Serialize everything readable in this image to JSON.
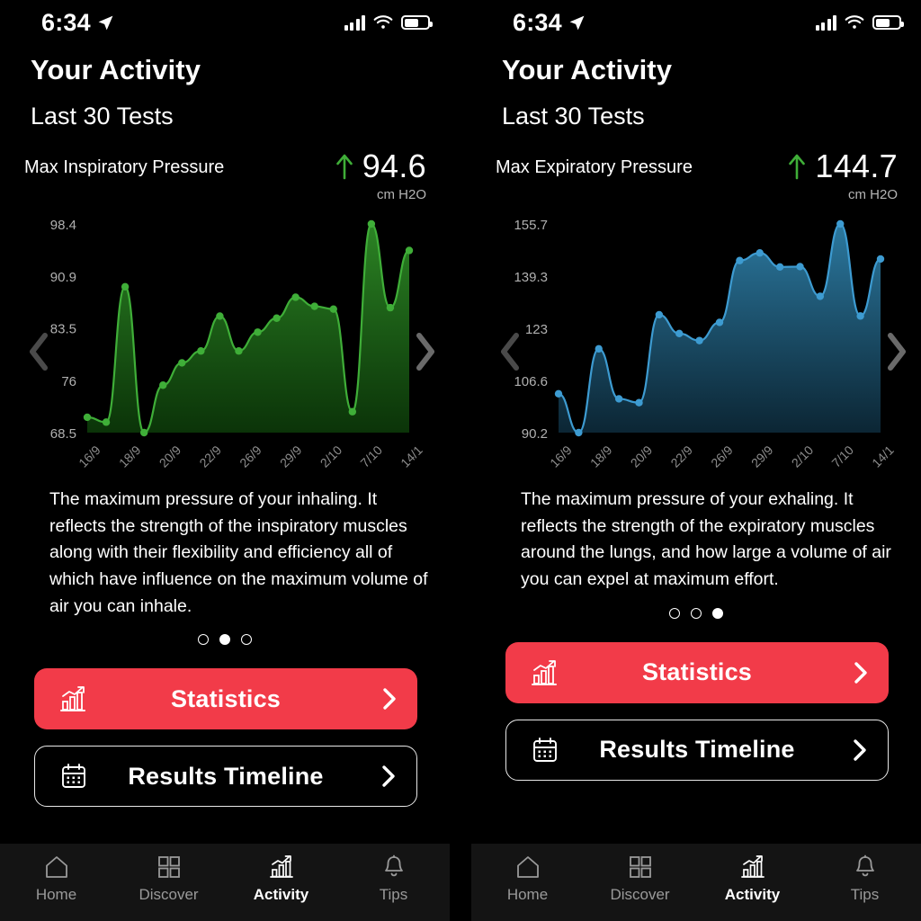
{
  "status_bar": {
    "time": "6:34",
    "icons": [
      "location-arrow-icon",
      "cellular-bars-icon",
      "wifi-icon",
      "battery-icon"
    ],
    "battery_level_pct": 62
  },
  "nav_tabs": [
    {
      "label": "Home",
      "icon": "home-icon",
      "active": false
    },
    {
      "label": "Discover",
      "icon": "grid-icon",
      "active": false
    },
    {
      "label": "Activity",
      "icon": "chart-up-icon",
      "active": true
    },
    {
      "label": "Tips",
      "icon": "bell-icon",
      "active": false
    }
  ],
  "colors": {
    "accent_red": "#f23b49",
    "green_line": "#3fae38",
    "blue_line": "#3d9bd1",
    "background": "#000000",
    "tabbar_bg": "#141414",
    "axis_text": "#b0b0b0"
  },
  "panels": [
    {
      "title": "Your Activity",
      "subtitle": "Last 30 Tests",
      "metric_name": "Max Inspiratory Pressure",
      "metric_value": "94.6",
      "metric_unit": "cm H2O",
      "trend": "up",
      "description": "The maximum pressure of your inhaling.  It reflects the strength of the inspiratory muscles along with their flexibility and efficiency all of which have influence on the maximum volume of air you can inhale.",
      "pager": {
        "count": 3,
        "active_index": 1
      },
      "buttons": [
        {
          "label": "Statistics",
          "icon": "bar-chart-icon",
          "chevron": "chevron-right-icon",
          "style": "primary"
        },
        {
          "label": "Results Timeline",
          "icon": "calendar-icon",
          "chevron": "chevron-right-icon",
          "style": "outline"
        }
      ],
      "prev_arrow": "chevron-left-icon",
      "next_arrow": "chevron-right-icon"
    },
    {
      "title": "Your Activity",
      "subtitle": "Last 30 Tests",
      "metric_name": "Max Expiratory Pressure",
      "metric_value": "144.7",
      "metric_unit": "cm H2O",
      "trend": "up",
      "description": "The maximum pressure of your exhaling. It reflects the strength of the expiratory muscles around the lungs, and how large a volume of air you can expel at maximum effort.",
      "pager": {
        "count": 3,
        "active_index": 2
      },
      "buttons": [
        {
          "label": "Statistics",
          "icon": "bar-chart-icon",
          "chevron": "chevron-right-icon",
          "style": "primary"
        },
        {
          "label": "Results Timeline",
          "icon": "calendar-icon",
          "chevron": "chevron-right-icon",
          "style": "outline"
        }
      ],
      "prev_arrow": "chevron-left-icon",
      "next_arrow": "chevron-right-icon"
    }
  ],
  "chart_data": [
    {
      "type": "area",
      "title": "Max Inspiratory Pressure",
      "xlabel": "",
      "ylabel": "cm H2O",
      "ylim": [
        68.5,
        98.4
      ],
      "yticks": [
        68.5,
        76,
        83.5,
        90.9,
        98.4
      ],
      "ytick_labels": [
        "68.5",
        "76",
        "83.5",
        "90.9",
        "98.4"
      ],
      "xtick_labels": [
        "16/9",
        "18/9",
        "20/9",
        "22/9",
        "26/9",
        "29/9",
        "2/10",
        "7/10",
        "14/1"
      ],
      "grid": false,
      "legend": "none",
      "line_color": "#3fae38",
      "values": [
        70.7,
        70.0,
        89.4,
        68.5,
        75.3,
        78.5,
        80.2,
        85.2,
        80.2,
        82.9,
        84.9,
        87.9,
        86.6,
        86.2,
        71.5,
        98.4,
        86.4,
        94.6
      ]
    },
    {
      "type": "area",
      "title": "Max Expiratory Pressure",
      "xlabel": "",
      "ylabel": "cm H2O",
      "ylim": [
        90.2,
        155.7
      ],
      "yticks": [
        90.2,
        106.6,
        123,
        139.3,
        155.7
      ],
      "ytick_labels": [
        "90.2",
        "106.6",
        "123",
        "139.3",
        "155.7"
      ],
      "xtick_labels": [
        "16/9",
        "18/9",
        "20/9",
        "22/9",
        "26/9",
        "29/9",
        "2/10",
        "7/10",
        "14/1"
      ],
      "grid": false,
      "legend": "none",
      "line_color": "#3d9bd1",
      "values": [
        102.4,
        90.2,
        116.5,
        100.8,
        99.6,
        127.2,
        121.3,
        119.1,
        124.8,
        144.2,
        146.6,
        142.2,
        142.3,
        133.0,
        155.7,
        126.8,
        144.7
      ]
    }
  ]
}
